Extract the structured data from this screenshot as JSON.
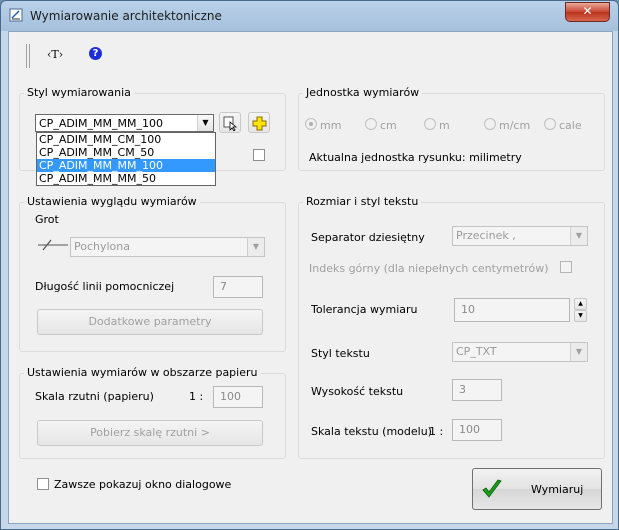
{
  "window": {
    "title": "Wymiarowanie architektoniczne",
    "close_label": "✕"
  },
  "toolbar": {
    "text_tool": "‹T›",
    "help": "?"
  },
  "dimension_style": {
    "legend": "Styl wymiarowania",
    "selected": "CP_ADIM_MM_MM_100",
    "options": [
      "CP_ADIM_MM_CM_100",
      "CP_ADIM_MM_CM_50",
      "CP_ADIM_MM_MM_100",
      "CP_ADIM_MM_MM_50"
    ],
    "selected_index": 2
  },
  "units": {
    "legend": "Jednostka wymiarów",
    "options": [
      "mm",
      "cm",
      "m",
      "m/cm",
      "cale"
    ],
    "checked_index": 0,
    "current_label": "Aktualna jednostka rysunku: milimetry"
  },
  "appearance": {
    "legend": "Ustawienia wyglądu wymiarów",
    "arrow_label": "Grot",
    "arrow_value": "Pochylona",
    "ext_line_label": "Długość linii pomocniczej",
    "ext_line_value": "7",
    "extra_params_button": "Dodatkowe parametry"
  },
  "paper": {
    "legend": "Ustawienia wymiarów w obszarze papieru",
    "scale_label": "Skala rzutni (papieru)",
    "scale_prefix": "1 :",
    "scale_value": "100",
    "fetch_button": "Pobierz skalę rzutni >"
  },
  "text_settings": {
    "legend": "Rozmiar i styl tekstu",
    "decimal_label": "Separator dziesiętny",
    "decimal_value": "Przecinek ,",
    "superscript_label": "Indeks górny (dla niepełnych centymetrów)",
    "tolerance_label": "Tolerancja wymiaru",
    "tolerance_value": "10",
    "style_label": "Styl tekstu",
    "style_value": "CP_TXT",
    "height_label": "Wysokość tekstu",
    "height_value": "3",
    "model_scale_label": "Skala tekstu (modelu)",
    "model_scale_prefix": "1 :",
    "model_scale_value": "100"
  },
  "footer": {
    "always_show_label": "Zawsze pokazuj okno dialogowe",
    "ok_button": "Wymiaruj"
  }
}
